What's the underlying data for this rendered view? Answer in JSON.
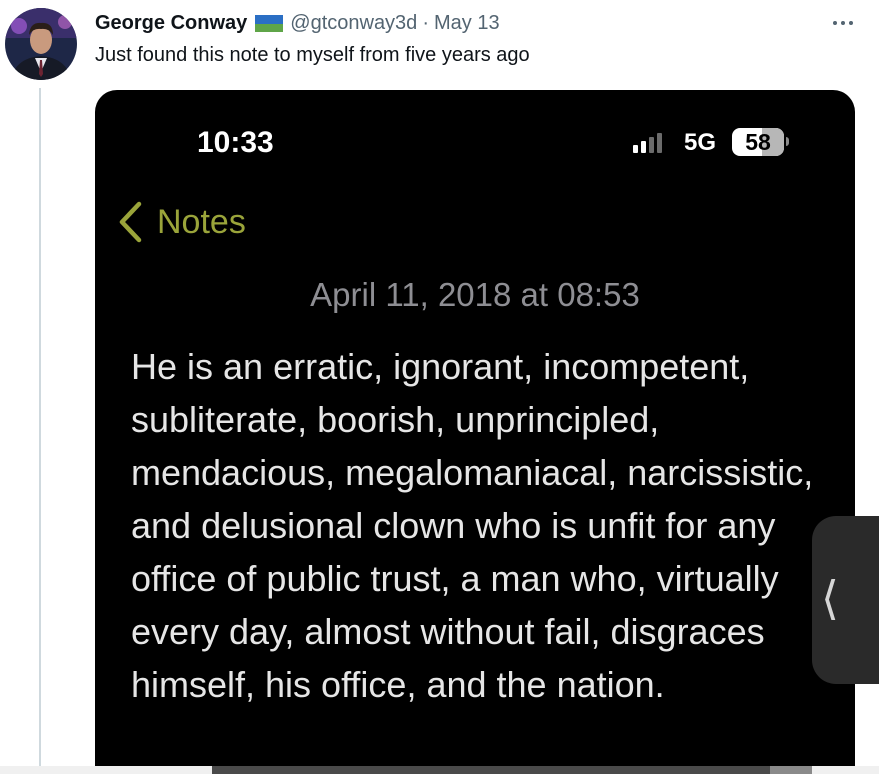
{
  "tweet": {
    "author_name": "George Conway",
    "handle": "@gtconway3d",
    "separator": "·",
    "date": "May 13",
    "text": "Just found this note to myself from five years ago",
    "flag_colors": [
      "#2b6fc4",
      "#5fa548"
    ],
    "more_icon": "more-horizontal-icon"
  },
  "phone_screenshot": {
    "status_bar": {
      "time": "10:33",
      "network": "5G",
      "battery_level": "58",
      "signal_bars_filled": 2,
      "signal_bars_total": 4
    },
    "nav": {
      "back_label": "Notes",
      "accent_color": "#9aa43a"
    },
    "note": {
      "date": "April 11, 2018 at 08:53",
      "body": "He is an erratic, ignorant, incompetent, subliterate, boorish, unprincipled, mendacious, megalomaniacal, narcissistic, and delusional clown who is unfit for any office of public trust, a man who, virtually every day, almost without fail, disgraces himself, his office, and the nation."
    }
  },
  "side_handle": {
    "icon": "chevron-left-icon"
  }
}
